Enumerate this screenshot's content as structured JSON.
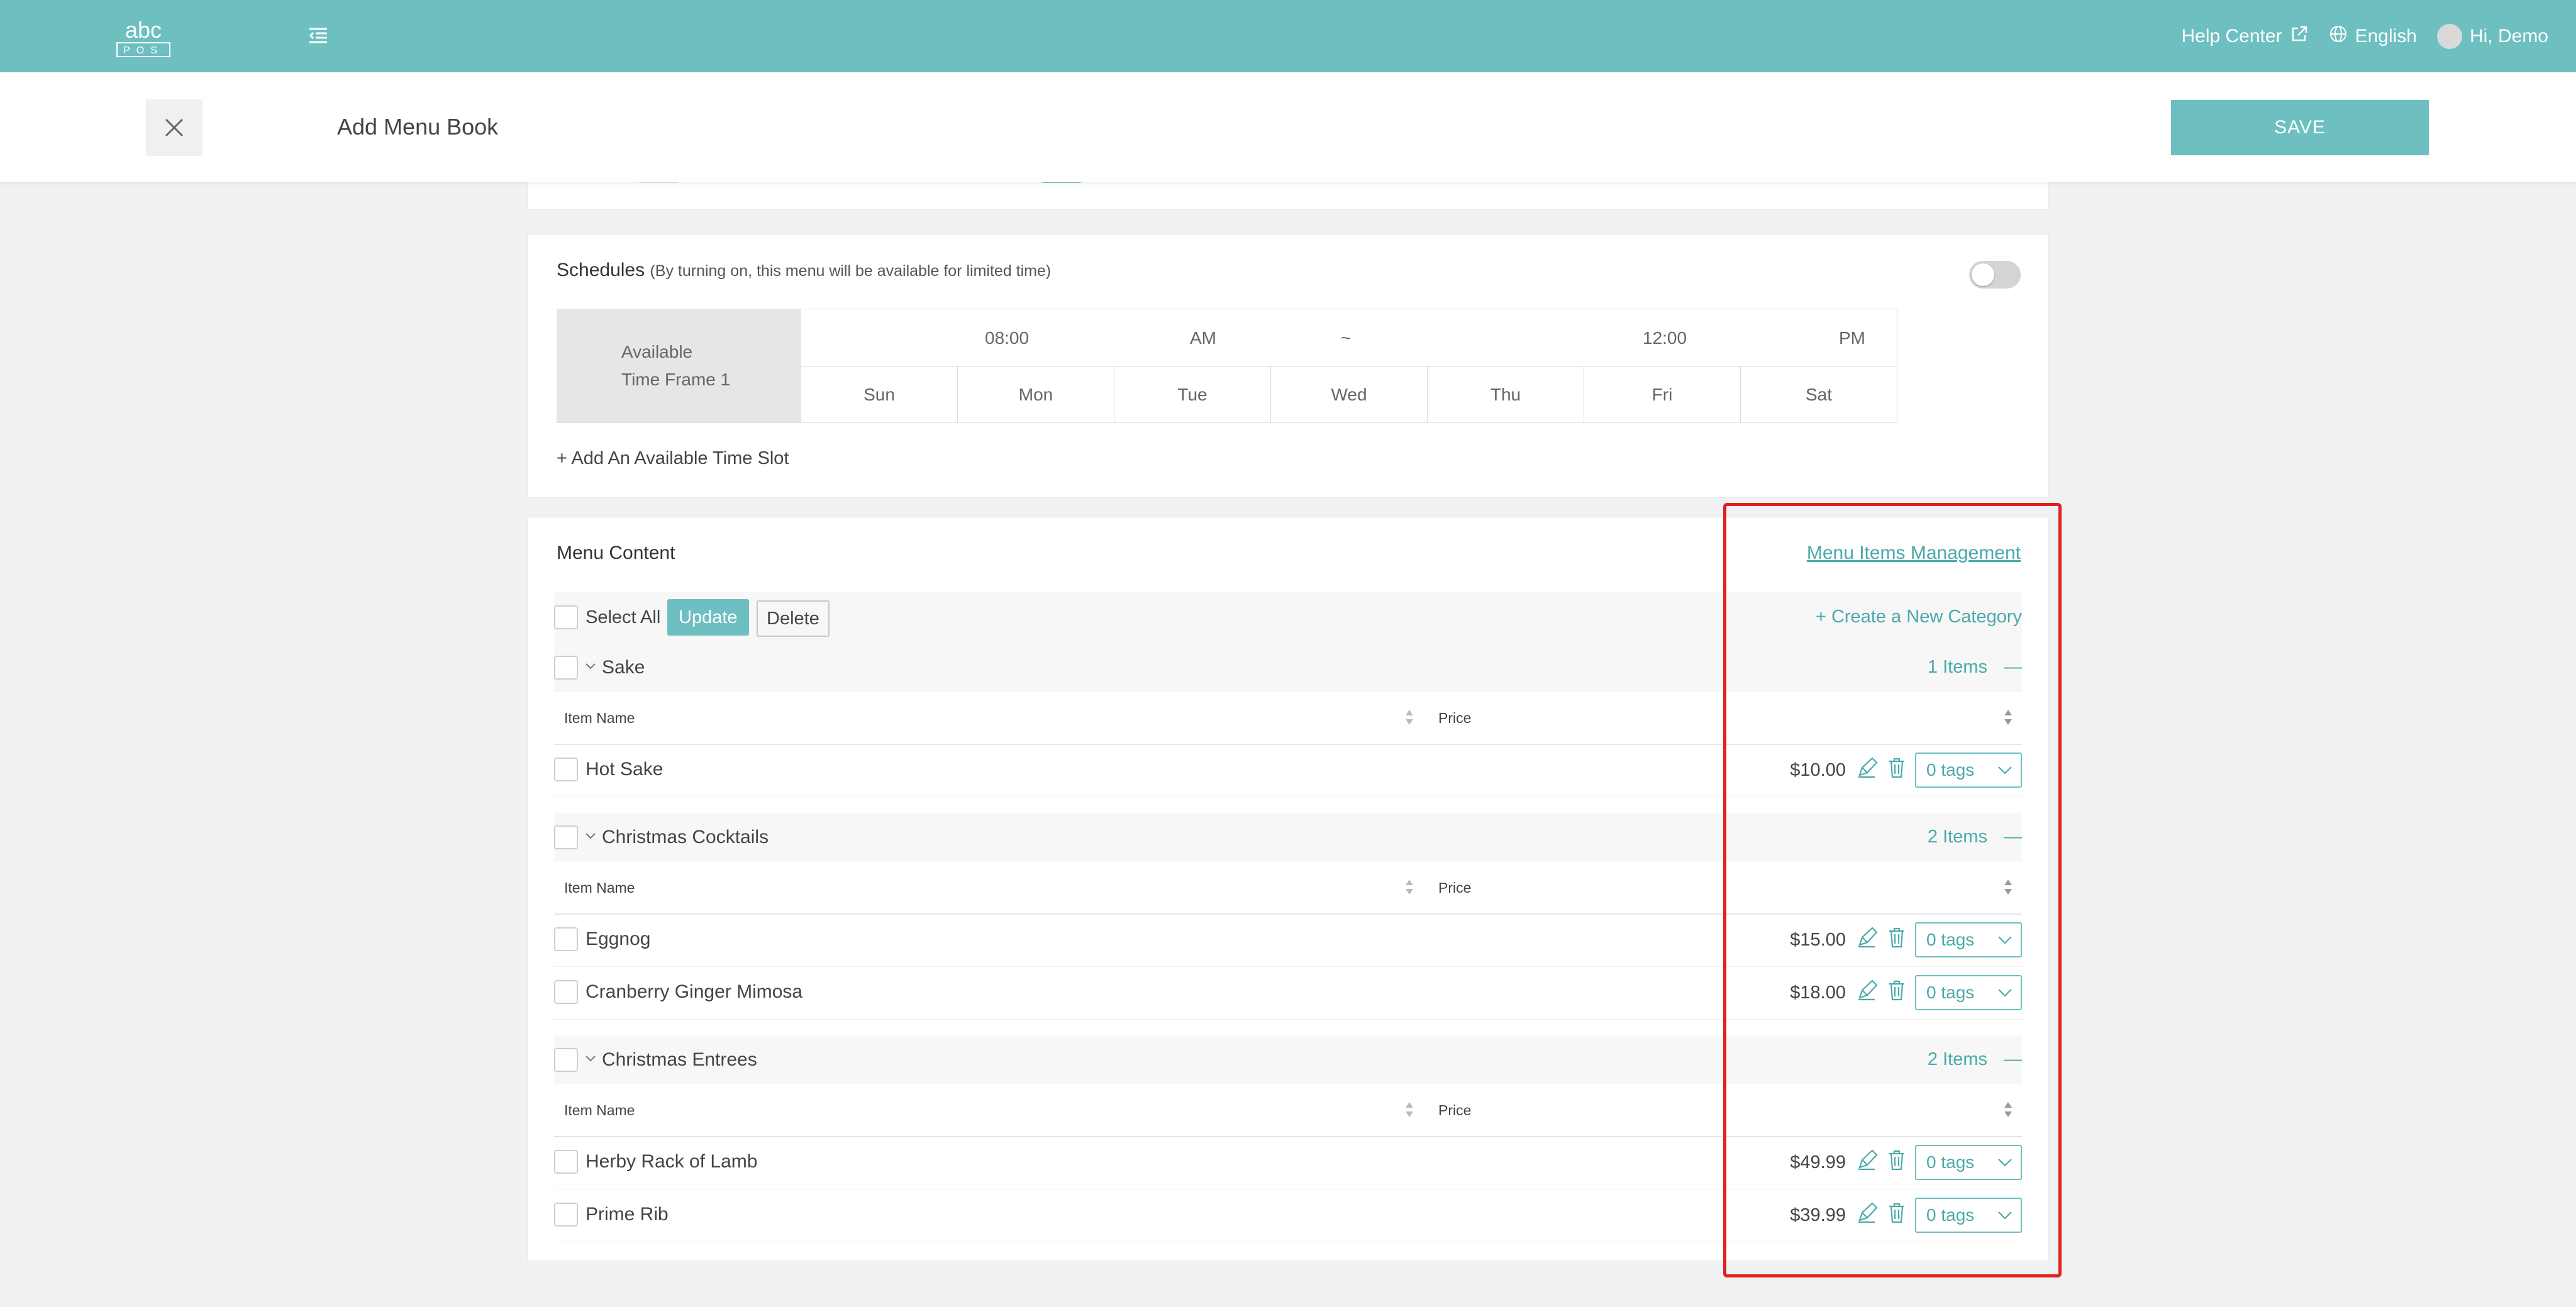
{
  "topbar": {
    "logo_text": "abc POS",
    "help_center": "Help Center",
    "language": "English",
    "greeting": "Hi, Demo"
  },
  "subheader": {
    "title": "Add Menu Book",
    "save_label": "SAVE"
  },
  "schedules": {
    "title": "Schedules",
    "hint": "(By turning on, this menu will be available for limited time)",
    "toggle_on": false,
    "timeframe_label_line1": "Available",
    "timeframe_label_line2": "Time Frame 1",
    "start_time": "08:00",
    "start_period": "AM",
    "separator": "~",
    "end_time": "12:00",
    "end_period": "PM",
    "days": [
      "Sun",
      "Mon",
      "Tue",
      "Wed",
      "Thu",
      "Fri",
      "Sat"
    ],
    "add_slot": "+ Add An Available Time Slot"
  },
  "menu_content": {
    "title": "Menu Content",
    "management_link": "Menu Items Management",
    "select_all": "Select All",
    "update_label": "Update",
    "delete_label": "Delete",
    "create_category": "+ Create a New Category",
    "col_item_name": "Item Name",
    "col_price": "Price",
    "collapse_symbol": "—",
    "categories": [
      {
        "name": "Sake",
        "count": "1 Items",
        "items": [
          {
            "name": "Hot Sake",
            "price": "$10.00",
            "tags": "0 tags"
          }
        ]
      },
      {
        "name": "Christmas Cocktails",
        "count": "2 Items",
        "items": [
          {
            "name": "Eggnog",
            "price": "$15.00",
            "tags": "0 tags"
          },
          {
            "name": "Cranberry Ginger Mimosa",
            "price": "$18.00",
            "tags": "0 tags"
          }
        ]
      },
      {
        "name": "Christmas Entrees",
        "count": "2 Items",
        "items": [
          {
            "name": "Herby Rack of Lamb",
            "price": "$49.99",
            "tags": "0 tags"
          },
          {
            "name": "Prime Rib",
            "price": "$39.99",
            "tags": "0 tags"
          }
        ]
      }
    ]
  },
  "colors": {
    "brand": "#6dbfc0",
    "link": "#4aaaa9",
    "highlight": "#e02020"
  }
}
